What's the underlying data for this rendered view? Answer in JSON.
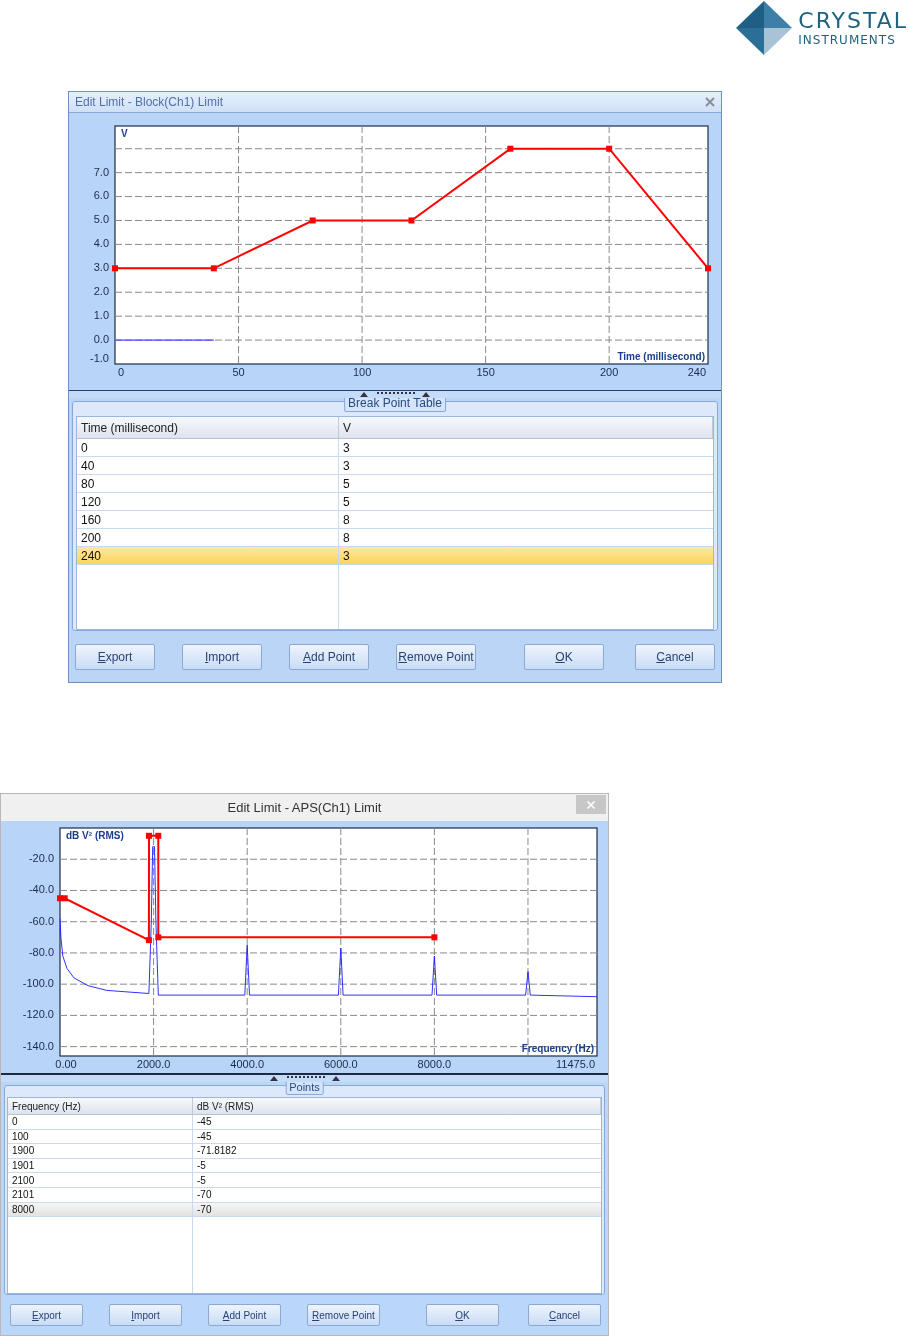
{
  "logo": {
    "name": "CRYSTAL",
    "subtitle": "INSTRUMENTS"
  },
  "dialogs": [
    {
      "kind": "ribbon",
      "title": "Edit Limit - Block(Ch1) Limit",
      "chart_data": {
        "type": "line",
        "ylabel": "V",
        "xlabel": "Time (millisecond)",
        "x": [
          0,
          40,
          80,
          120,
          160,
          200,
          240
        ],
        "series": [
          {
            "color": "#ff0000",
            "marker": "square",
            "values": [
              3,
              3,
              5,
              5,
              8,
              8,
              3
            ]
          },
          {
            "color": "#4a4aff",
            "values": [
              0,
              0,
              null,
              null,
              null,
              null,
              null
            ]
          }
        ],
        "grid": true,
        "xlim": [
          0,
          240
        ],
        "ylim": [
          -1,
          8.95
        ],
        "xticks": [
          0,
          50,
          100,
          150,
          200,
          240
        ],
        "yticks": [
          {
            "value": -1,
            "label": "-1.0"
          },
          {
            "value": 0,
            "label": "0.0"
          },
          {
            "value": 1,
            "label": "1.0"
          },
          {
            "value": 2,
            "label": "2.0"
          },
          {
            "value": 3,
            "label": "3.0"
          },
          {
            "value": 4,
            "label": "4.0"
          },
          {
            "value": 5,
            "label": "5.0"
          },
          {
            "value": 6,
            "label": "6.0"
          },
          {
            "value": 7,
            "label": "7.0"
          }
        ]
      },
      "group_title": "Break Point Table",
      "table": {
        "columns": [
          "Time (millisecond)",
          "V"
        ],
        "rows": [
          {
            "cells": [
              "0",
              "3"
            ],
            "selected": false
          },
          {
            "cells": [
              "40",
              "3"
            ],
            "selected": false
          },
          {
            "cells": [
              "80",
              "5"
            ],
            "selected": false
          },
          {
            "cells": [
              "120",
              "5"
            ],
            "selected": false
          },
          {
            "cells": [
              "160",
              "8"
            ],
            "selected": false
          },
          {
            "cells": [
              "200",
              "8"
            ],
            "selected": false
          },
          {
            "cells": [
              "240",
              "3"
            ],
            "selected": true
          }
        ]
      },
      "edit_buttons": [
        {
          "label": "Export",
          "mnemonic": true
        },
        {
          "label": "Import",
          "mnemonic": true
        },
        {
          "label": "Add Point",
          "mnemonic": true
        },
        {
          "label": "Remove Point",
          "mnemonic": true
        }
      ],
      "dialog_buttons": [
        {
          "label": "OK",
          "mnemonic": true
        },
        {
          "label": "Cancel",
          "mnemonic": true
        }
      ]
    },
    {
      "kind": "modern",
      "title": "Edit Limit - APS(Ch1) Limit",
      "chart_data": {
        "type": "line",
        "ylabel": "dB V² (RMS)",
        "xlabel": "Frequency (Hz)",
        "x": [
          0,
          100,
          1900,
          1901,
          2100,
          2101,
          8000
        ],
        "series": [
          {
            "color": "#ff0000",
            "marker": "square",
            "values": [
              -45,
              -45,
              -71.8,
              -5,
              -5,
              -70,
              -70
            ]
          },
          {
            "color": "#1a1aff",
            "x": [
              0,
              20,
              60,
              150,
              300,
              600,
              1000,
              1900,
              1950,
              1980,
              2020,
              2050,
              2100,
              3950,
              4000,
              4050,
              5950,
              6000,
              6050,
              7950,
              8000,
              8050,
              9950,
              10000,
              10050,
              11475
            ],
            "values": [
              -58,
              -70,
              -82,
              -90,
              -96,
              -101,
              -104,
              -106,
              -60,
              -12,
              -12,
              -60,
              -107,
              -107,
              -75,
              -107,
              -107,
              -77,
              -107,
              -107,
              -82,
              -107,
              -107,
              -92,
              -107,
              -108
            ]
          }
        ],
        "grid": true,
        "xlim": [
          0,
          11475
        ],
        "ylim": [
          -146,
          0
        ],
        "xticks": [
          {
            "value": 0,
            "label": "0.00"
          },
          {
            "value": 2000,
            "label": "2000.0"
          },
          {
            "value": 4000,
            "label": "4000.0"
          },
          {
            "value": 6000,
            "label": "6000.0"
          },
          {
            "value": 8000,
            "label": "8000.0"
          },
          {
            "value": 11475,
            "label": "11475.0"
          }
        ],
        "yticks": [
          {
            "value": -140,
            "label": "-140.0"
          },
          {
            "value": -120,
            "label": "-120.0"
          },
          {
            "value": -100,
            "label": "-100.0"
          },
          {
            "value": -80,
            "label": "-80.0"
          },
          {
            "value": -60,
            "label": "-60.0"
          },
          {
            "value": -40,
            "label": "-40.0"
          },
          {
            "value": -20,
            "label": "-20.0"
          }
        ]
      },
      "group_title": "Points",
      "table": {
        "columns": [
          "Frequency (Hz)",
          "dB V² (RMS)"
        ],
        "rows": [
          {
            "cells": [
              "0",
              "-45"
            ],
            "selected": false
          },
          {
            "cells": [
              "100",
              "-45"
            ],
            "selected": false
          },
          {
            "cells": [
              "1900",
              "-71.8182"
            ],
            "selected": false
          },
          {
            "cells": [
              "1901",
              "-5"
            ],
            "selected": false
          },
          {
            "cells": [
              "2100",
              "-5"
            ],
            "selected": false
          },
          {
            "cells": [
              "2101",
              "-70"
            ],
            "selected": false
          },
          {
            "cells": [
              "8000",
              "-70"
            ],
            "selected": true
          }
        ]
      },
      "edit_buttons": [
        {
          "label": "Export",
          "mnemonic": true
        },
        {
          "label": "Import",
          "mnemonic": true
        },
        {
          "label": "Add Point",
          "mnemonic": true
        },
        {
          "label": "Remove Point",
          "mnemonic": true
        }
      ],
      "dialog_buttons": [
        {
          "label": "OK",
          "mnemonic": true
        },
        {
          "label": "Cancel",
          "mnemonic": true
        }
      ]
    }
  ]
}
